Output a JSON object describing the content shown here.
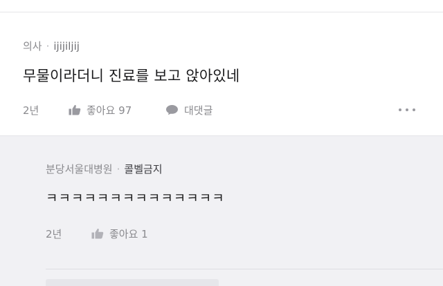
{
  "comment": {
    "author_label": "의사",
    "separator": "·",
    "nickname": "ijijiljij",
    "text": "무물이라더니 진료를 보고 앉아있네",
    "time": "2년",
    "like_label": "좋아요 97",
    "reply_label": "대댓글",
    "more_icon": "more-dots-icon"
  },
  "reply": {
    "author_label": "분당서울대병원",
    "separator": "·",
    "nickname": "콜벨금지",
    "text": "ㅋㅋㅋㅋㅋㅋㅋㅋㅋㅋㅋㅋㅋㅋ",
    "time": "2년",
    "like_label": "좋아요 1"
  },
  "colors": {
    "page_bg": "#ffffff",
    "reply_bg": "#f1f1f4",
    "muted_text": "#8a8a8e",
    "icon": "#9a9aa0"
  }
}
